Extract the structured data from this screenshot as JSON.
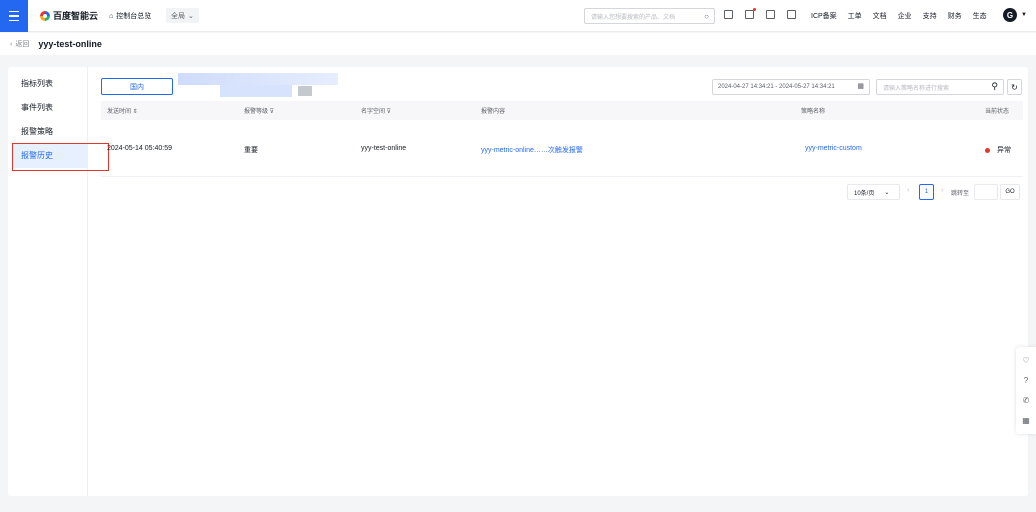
{
  "topbar": {
    "logo_text": "百度智能云",
    "home_label": "控制台总览",
    "region_label": "全局",
    "search_placeholder": "请输入您想要搜索的产品、文档",
    "nav": [
      "ICP备案",
      "工单",
      "文档",
      "企业",
      "支持",
      "财务",
      "生态"
    ],
    "avatar_letter": "G"
  },
  "breadcrumb": {
    "back_label": "返回",
    "title": "yyy-test-online"
  },
  "sidebar": {
    "items": [
      {
        "label": "指标列表",
        "active": false
      },
      {
        "label": "事件列表",
        "active": false
      },
      {
        "label": "报警策略",
        "active": false
      },
      {
        "label": "报警历史",
        "active": true
      }
    ]
  },
  "toolbar": {
    "tab_label": "国内",
    "date_range": "2024-04-27 14:34:21 - 2024-05-27 14:34:21",
    "search_placeholder": "请输入策略名称进行搜索"
  },
  "table": {
    "headers": [
      "发送时间 ⇕",
      "报警等级 ⊽",
      "名字空间 ⊽",
      "报警内容",
      "策略名称",
      "当前状态"
    ],
    "rows": [
      {
        "time": "2024-05-14 05:40:59",
        "level": "重要",
        "namespace": "yyy-test-online",
        "content": "yyy-metric-online……次触发报警",
        "policy": "yyy-metric-custom",
        "status": "异常"
      }
    ]
  },
  "pagination": {
    "page_size": "10条/页",
    "current_page": "1",
    "jump_label": "跳转至",
    "go_label": "GO"
  },
  "colors": {
    "accent": "#2468f2",
    "danger": "#e1382c"
  }
}
